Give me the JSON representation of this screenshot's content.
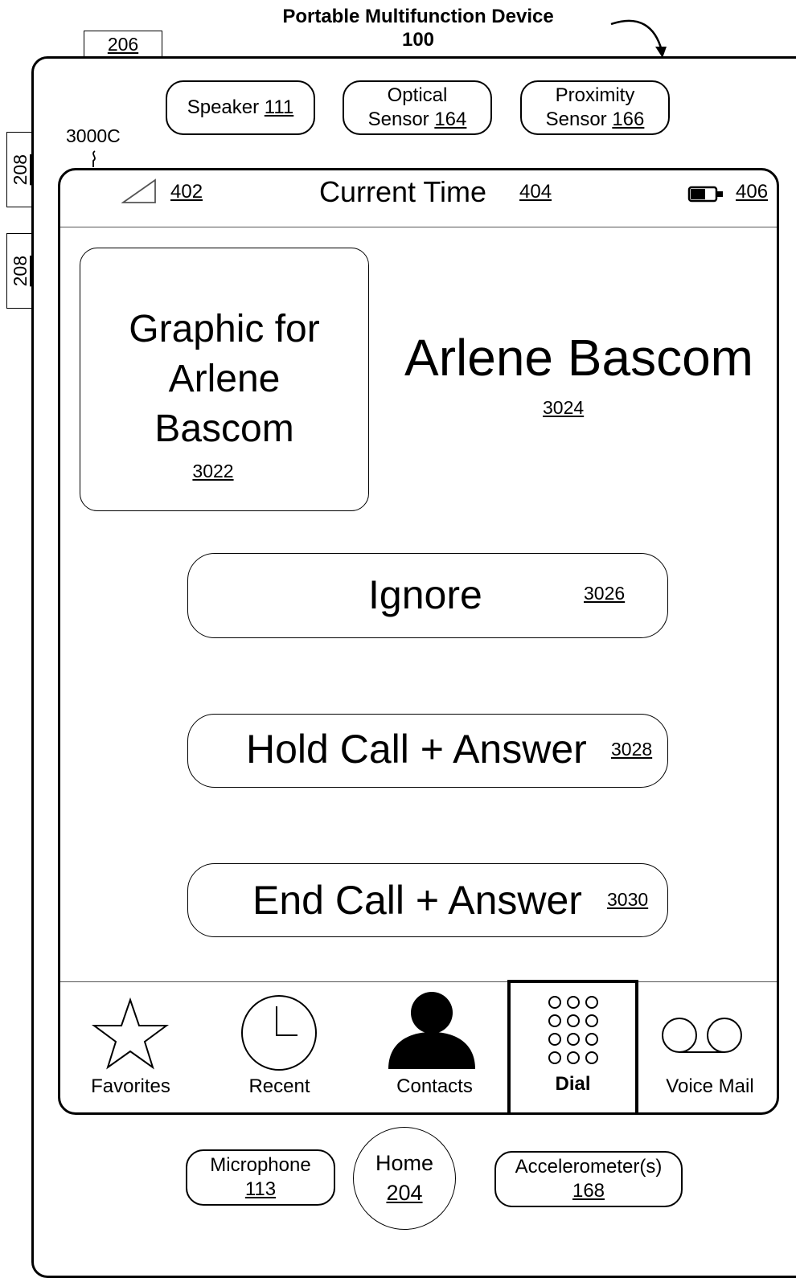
{
  "header": {
    "title_line1": "Portable Multifunction Device",
    "title_line2": "100"
  },
  "refs": {
    "button_top": "206",
    "button_side_1": "208",
    "button_side_2": "208",
    "screen_ref": "3000C"
  },
  "hardware": {
    "speaker": {
      "label": "Speaker",
      "ref": "111"
    },
    "optical_sensor": {
      "line1": "Optical",
      "line2": "Sensor",
      "ref": "164"
    },
    "proximity_sensor": {
      "line1": "Proximity",
      "line2": "Sensor",
      "ref": "166"
    },
    "microphone": {
      "label": "Microphone",
      "ref": "113"
    },
    "home": {
      "label": "Home",
      "ref": "204"
    },
    "accelerometer": {
      "label": "Accelerometer(s)",
      "ref": "168"
    }
  },
  "status_bar": {
    "signal_ref": "402",
    "time_label": "Current Time",
    "time_ref": "404",
    "battery_ref": "406"
  },
  "caller": {
    "graphic_line1": "Graphic for",
    "graphic_line2": "Arlene",
    "graphic_line3": "Bascom",
    "graphic_ref": "3022",
    "name": "Arlene Bascom",
    "name_ref": "3024"
  },
  "actions": {
    "ignore": {
      "label": "Ignore",
      "ref": "3026"
    },
    "hold_answer": {
      "label": "Hold Call + Answer",
      "ref": "3028"
    },
    "end_answer": {
      "label": "End Call + Answer",
      "ref": "3030"
    }
  },
  "tabs": [
    {
      "label": "Favorites",
      "icon": "star-icon"
    },
    {
      "label": "Recent",
      "icon": "clock-icon"
    },
    {
      "label": "Contacts",
      "icon": "person-icon"
    },
    {
      "label": "Dial",
      "icon": "keypad-icon",
      "selected": true
    },
    {
      "label": "Voice Mail",
      "icon": "voicemail-icon"
    }
  ]
}
